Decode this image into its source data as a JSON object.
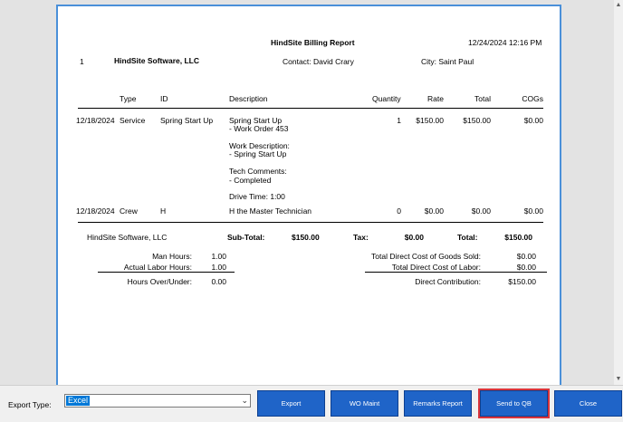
{
  "report": {
    "title": "HindSite Billing Report",
    "datetime": "12/24/2024 12:16 PM",
    "record_no": "1",
    "company": "HindSite Software, LLC",
    "contact": "Contact: David Crary",
    "city": "City:  Saint Paul"
  },
  "table": {
    "headers": {
      "type": "Type",
      "id": "ID",
      "description": "Description",
      "quantity": "Quantity",
      "rate": "Rate",
      "total": "Total",
      "cogs": "COGs"
    },
    "rows": [
      {
        "date": "12/18/2024",
        "type": "Service",
        "id": "Spring Start Up",
        "description_lines": [
          "Spring Start Up",
          "- Work Order 453",
          "Work Description:",
          "- Spring Start Up",
          "Tech Comments:",
          "- Completed",
          "Drive Time: 1:00"
        ],
        "quantity": "1",
        "rate": "$150.00",
        "total": "$150.00",
        "cogs": "$0.00"
      },
      {
        "date": "12/18/2024",
        "type": "Crew",
        "id": "H",
        "description_lines": [
          "H the Master Technician"
        ],
        "quantity": "0",
        "rate": "$0.00",
        "total": "$0.00",
        "cogs": "$0.00"
      }
    ]
  },
  "summary": {
    "company": "HindSite Software, LLC",
    "subtotal_label": "Sub-Total:",
    "subtotal_value": "$150.00",
    "tax_label": "Tax:",
    "tax_value": "$0.00",
    "total_label": "Total:",
    "total_value": "$150.00",
    "man_hours_label": "Man Hours:",
    "man_hours_value": "1.00",
    "actual_labor_label": "Actual Labor Hours:",
    "actual_labor_value": "1.00",
    "over_under_label": "Hours Over/Under:",
    "over_under_value": "0.00",
    "cogs_label": "Total Direct Cost of Goods Sold:",
    "cogs_value": "$0.00",
    "labor_cost_label": "Total Direct Cost of Labor:",
    "labor_cost_value": "$0.00",
    "contribution_label": "Direct Contribution:",
    "contribution_value": "$150.00"
  },
  "bottombar": {
    "export_type_label": "Export Type:",
    "export_type_value": "Excel",
    "buttons": {
      "export": "Export",
      "wo_maint": "WO Maint",
      "remarks_report": "Remarks Report",
      "send_to_qb": "Send to QB",
      "close": "Close"
    }
  },
  "icons": {
    "scroll_up": "scroll-up-arrow",
    "scroll_down": "scroll-down-arrow",
    "dropdown": "chevron-down"
  }
}
